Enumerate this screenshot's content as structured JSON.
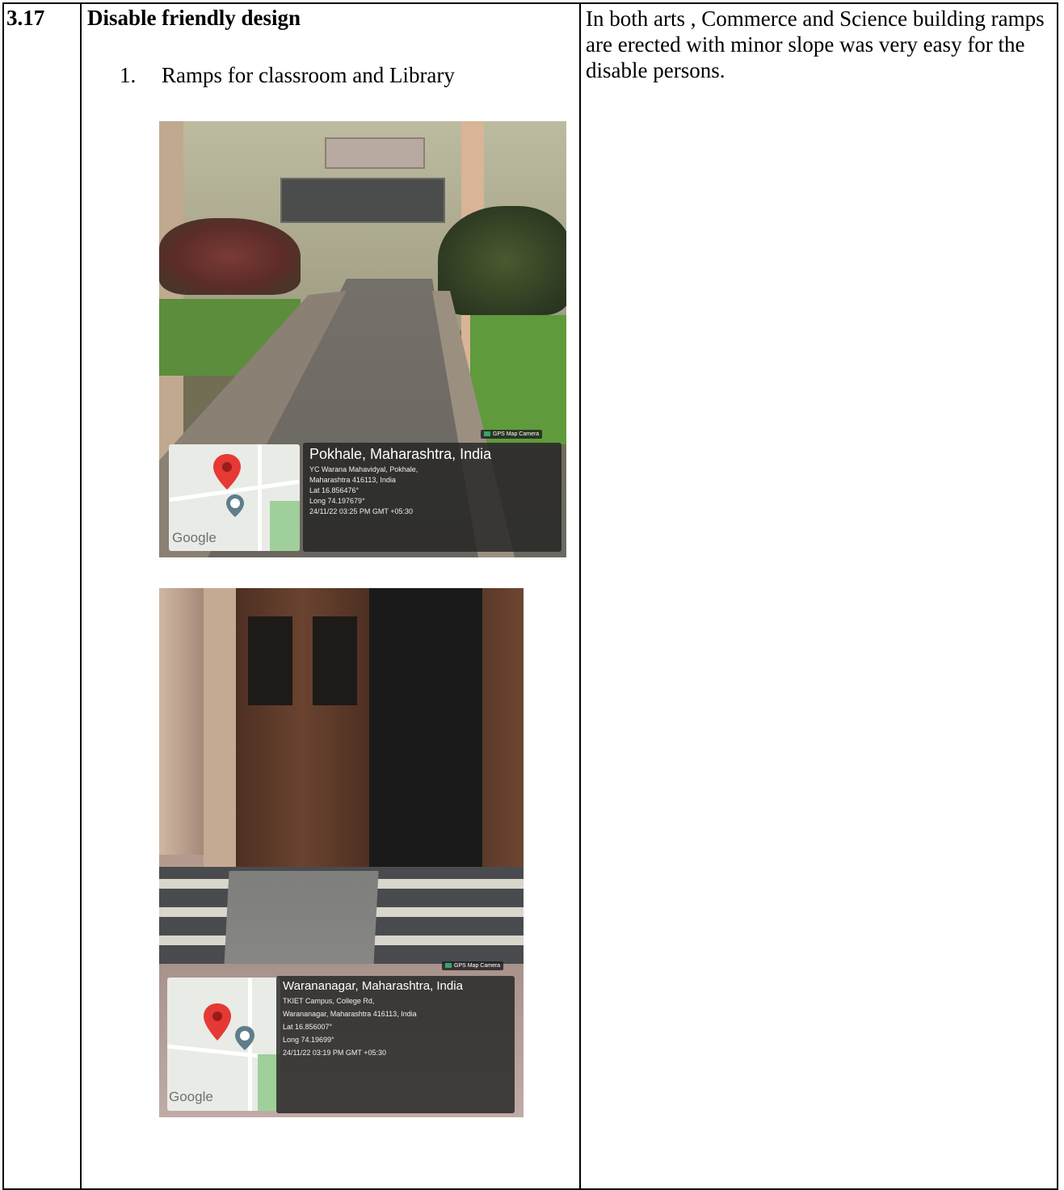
{
  "row": {
    "number": "3.17",
    "title": "Disable friendly design",
    "list_number": "1.",
    "list_item": "Ramps for classroom and Library",
    "description": "In both arts , Commerce and Science building ramps are erected with minor slope was very easy for the disable persons."
  },
  "photos": [
    {
      "map_brand": "Google",
      "camera_tag": "GPS Map Camera",
      "location": "Pokhale, Maharashtra, India",
      "address_line1": "YC Warana Mahavidyal, Pokhale,",
      "address_line2": "Maharashtra 416113, India",
      "lat": "Lat 16.856476°",
      "long": "Long 74.197679°",
      "timestamp": "24/11/22 03:25 PM GMT +05:30"
    },
    {
      "map_brand": "Google",
      "camera_tag": "GPS Map Camera",
      "location": "Warananagar, Maharashtra, India",
      "address_line1": "TKIET Campus, College Rd,",
      "address_line2": "Warananagar, Maharashtra 416113, India",
      "lat": "Lat 16.856007°",
      "long": "Long 74.19699°",
      "timestamp": "24/11/22 03:19 PM GMT +05:30"
    }
  ],
  "colors": {
    "map_pin": "#e53935",
    "map_pin_secondary": "#607d8b",
    "gps_panel": "#232323"
  }
}
